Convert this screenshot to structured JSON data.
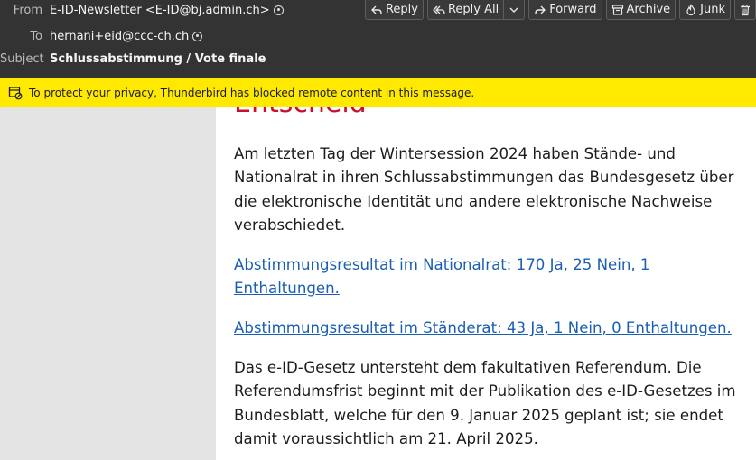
{
  "header": {
    "from_label": "From",
    "from_value": "E-ID-Newsletter <E-ID@bj.admin.ch>",
    "to_label": "To",
    "to_value": "hernani+eid@ccc-ch.ch",
    "subject_label": "Subject",
    "subject_value": "Schlussabstimmung / Vote finale"
  },
  "toolbar": {
    "reply": "Reply",
    "reply_all": "Reply All",
    "forward": "Forward",
    "archive": "Archive",
    "junk": "Junk"
  },
  "notice": {
    "text": "To protect your privacy, Thunderbird has blocked remote content in this message."
  },
  "message": {
    "heading_partial": "Entscheid",
    "para1": "Am letzten Tag der Wintersession 2024 haben Stände- und Nationalrat in ihren Schlussabstimmungen das Bundesgesetz über die elektronische Identität und andere elektronische Nachweise verabschiedet.",
    "link1": "Abstimmungsresultat im Nationalrat: 170 Ja, 25 Nein, 1 Enthaltungen.",
    "link2": "Abstimmungsresultat im Ständerat: 43 Ja, 1 Nein, 0 Enthaltungen.",
    "para2": "Das e-ID-Gesetz untersteht dem fakultativen Referendum. Die Referendumsfrist beginnt mit der Publikation des e-ID-Gesetzes im Bundesblatt, welche für den 9. Januar 2025 geplant ist; sie endet damit voraussichtlich am 21. April 2025."
  },
  "colors": {
    "header_bg": "#333333",
    "notice_bg": "#ffe900",
    "link": "#1a5fb4",
    "heading_red": "#c8102e"
  }
}
